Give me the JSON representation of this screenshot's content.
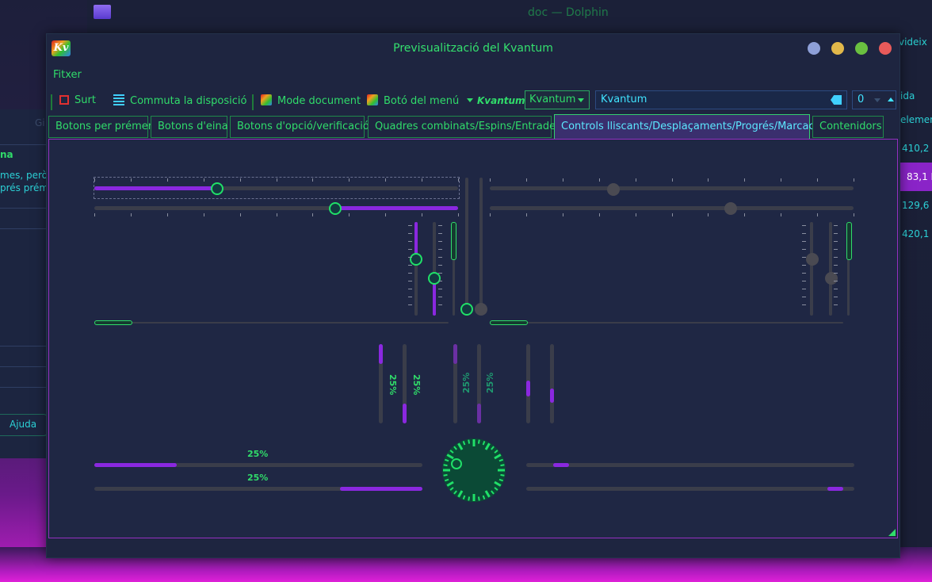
{
  "background": {
    "window_title": "doc — Dolphin",
    "left_fragments": [
      "Gi",
      "na",
      "mes, però t",
      "prés prémε",
      "Ajuda"
    ],
    "right_fragments": [
      "videix",
      "ida",
      "elemen",
      "410,2 K",
      "83,1 K",
      "129,6 K",
      "420,1 K"
    ]
  },
  "window": {
    "title": "Previsualització del Kvantum",
    "icon_label": "Kv"
  },
  "menubar": {
    "file": "Fitxer"
  },
  "toolbar": {
    "quit": "Surt",
    "toggle_layout": "Commuta la disposició",
    "document_mode": "Mode document",
    "menu_button": "Botó del menú",
    "kvantum_label": "Kvantum",
    "combo_value": "Kvantum",
    "line_edit_value": "Kvantum",
    "spin_value": "0"
  },
  "tabs": [
    "Botons per prémer",
    "Botons d'eina",
    "Botons d'opció/verificació",
    "Quadres combinats/Espins/Entrades",
    "Controls lliscants/Desplaçaments/Progrés/Marcació",
    "Contenidors"
  ],
  "active_tab_index": 4,
  "progress": {
    "horizontal_top_value": 0.25,
    "horizontal_top_label": "25%",
    "horizontal_bottom_value": 0.25,
    "horizontal_bottom_label": "25%",
    "vertical_labels": [
      "25%",
      "25%",
      "25%",
      "25%"
    ]
  },
  "colors": {
    "accent_green": "#30dc6a",
    "accent_purple": "#8a28e0",
    "active_tab_text": "#5ce8ff",
    "close": "#e85a5a",
    "maximize": "#6ac040",
    "minimize": "#e2b84a",
    "shade": "#8ea0d8"
  }
}
